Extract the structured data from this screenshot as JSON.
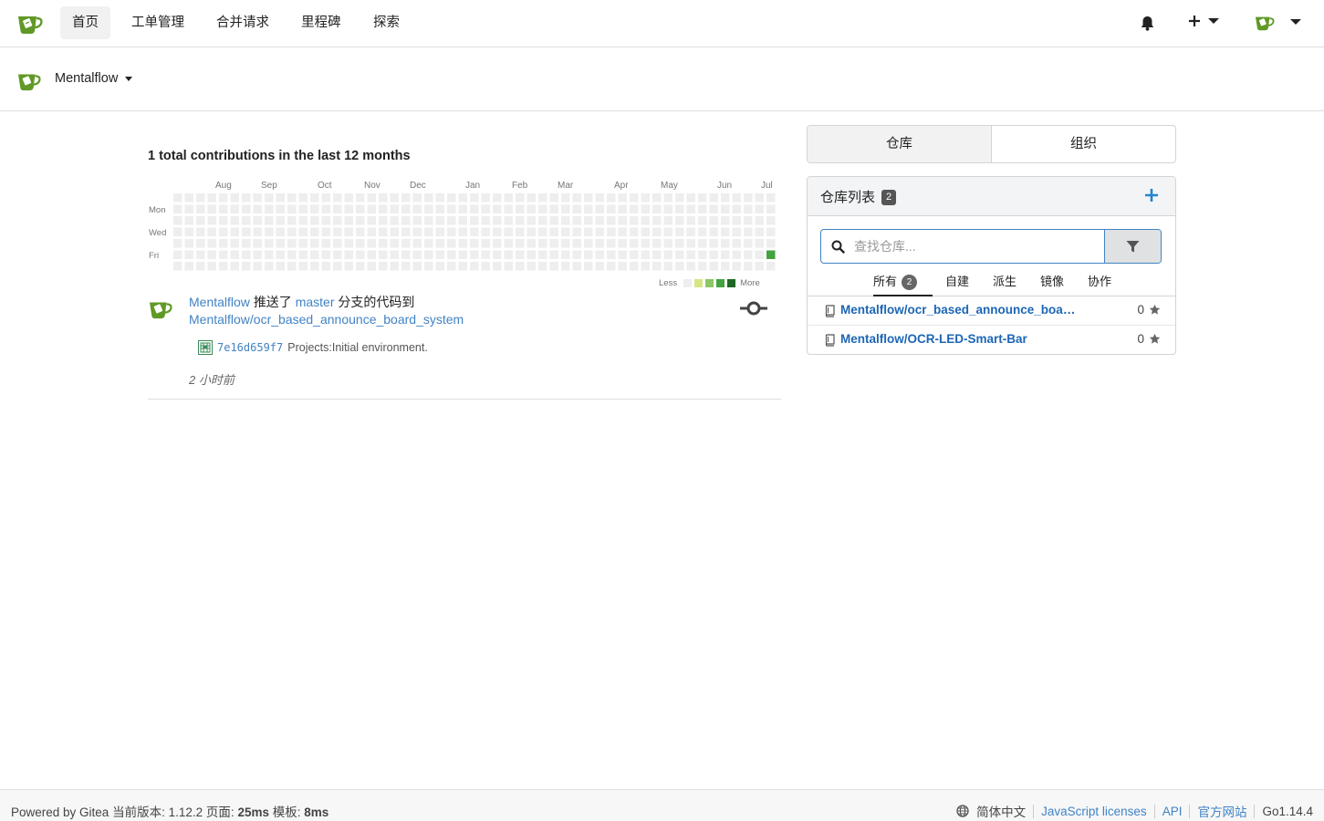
{
  "nav": {
    "items": [
      {
        "label": "首页",
        "active": true
      },
      {
        "label": "工单管理"
      },
      {
        "label": "合并请求"
      },
      {
        "label": "里程碑"
      },
      {
        "label": "探索"
      }
    ],
    "icons": [
      "bell-icon",
      "plus-icon",
      "avatar-icon"
    ]
  },
  "context": {
    "user": "Mentalflow"
  },
  "heatmap": {
    "title": "1 total contributions in the last 12 months",
    "months": [
      "Aug",
      "Sep",
      "Oct",
      "Nov",
      "Dec",
      "Jan",
      "Feb",
      "Mar",
      "Apr",
      "May",
      "Jun",
      "Jul"
    ],
    "days": [
      "Mon",
      "Wed",
      "Fri"
    ],
    "weeks": 53,
    "active_cell": {
      "week": 52,
      "weekday": 5,
      "count": 1
    },
    "legend_less": "Less",
    "legend_more": "More",
    "colors": [
      "#eeeeee",
      "#d6e685",
      "#8cc665",
      "#44a340",
      "#1e6823"
    ]
  },
  "feed": {
    "user": "Mentalflow",
    "action": "推送了",
    "branch": "master",
    "action2": "分支的代码到",
    "repo": "Mentalflow/ocr_based_announce_board_system",
    "sha": "7e16d659f7",
    "message": "Projects:Initial environment.",
    "time": "2 小时前"
  },
  "right": {
    "tabs": [
      {
        "label": "仓库",
        "active": true
      },
      {
        "label": "组织"
      }
    ],
    "repo_list_title": "仓库列表",
    "repo_count": "2",
    "search_placeholder": "查找仓库...",
    "subtabs": [
      {
        "label": "所有",
        "badge": "2",
        "active": true
      },
      {
        "label": "自建"
      },
      {
        "label": "派生"
      },
      {
        "label": "镜像"
      },
      {
        "label": "协作"
      }
    ],
    "repos": [
      {
        "name": "Mentalflow/ocr_based_announce_board_system",
        "stars": "0"
      },
      {
        "name": "Mentalflow/OCR-LED-Smart-Bar",
        "stars": "0"
      }
    ]
  },
  "footer": {
    "powered": "Powered by Gitea",
    "version_label": "当前版本:",
    "version": "1.12.2",
    "page_label": "页面:",
    "page_time": "25ms",
    "tpl_label": "模板:",
    "tpl_time": "8ms",
    "language": "简体中文",
    "js_licenses": "JavaScript licenses",
    "api": "API",
    "website": "官方网站",
    "go_version": "Go1.14.4"
  },
  "accent": "#4183c4",
  "brand": "#609926"
}
